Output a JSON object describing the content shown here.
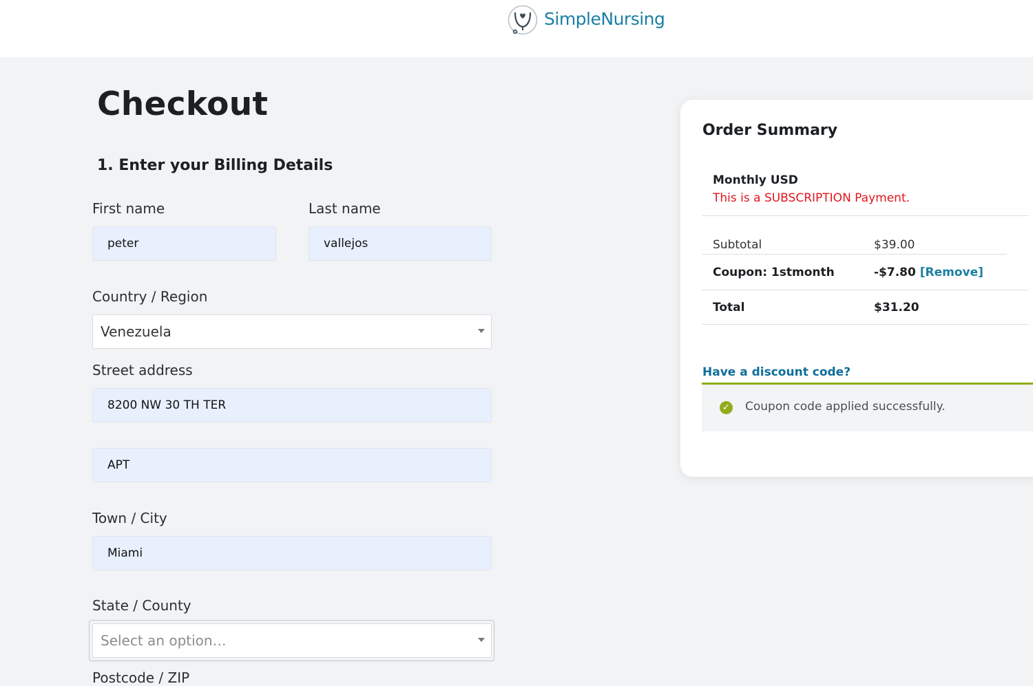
{
  "header": {
    "brand": "SimpleNursing",
    "brand_color": "#1b7fa3"
  },
  "page": {
    "title": "Checkout",
    "section": "1. Enter your Billing Details"
  },
  "form": {
    "first_name": {
      "label": "First name",
      "value": "peter"
    },
    "last_name": {
      "label": "Last name",
      "value": "vallejos"
    },
    "country": {
      "label": "Country / Region",
      "value": "Venezuela"
    },
    "street": {
      "label": "Street address",
      "value": "8200 NW 30 TH TER",
      "value2": "APT"
    },
    "city": {
      "label": "Town / City",
      "value": "Miami"
    },
    "state": {
      "label": "State / County",
      "placeholder": "Select an option…"
    },
    "postcode": {
      "label": "Postcode / ZIP"
    }
  },
  "summary": {
    "title": "Order Summary",
    "plan": "Monthly USD",
    "plan_note": "This is a SUBSCRIPTION Payment.",
    "subtotal_label": "Subtotal",
    "subtotal_value": "$39.00",
    "coupon_label": "Coupon: 1stmonth",
    "coupon_value": "-$7.80",
    "coupon_remove": "[Remove]",
    "total_label": "Total",
    "total_value": "$31.20",
    "discount_link": "Have a discount code?",
    "success_message": "Coupon code applied successfully.",
    "note_color": "#e0161c",
    "success_color": "#8fae1b"
  }
}
